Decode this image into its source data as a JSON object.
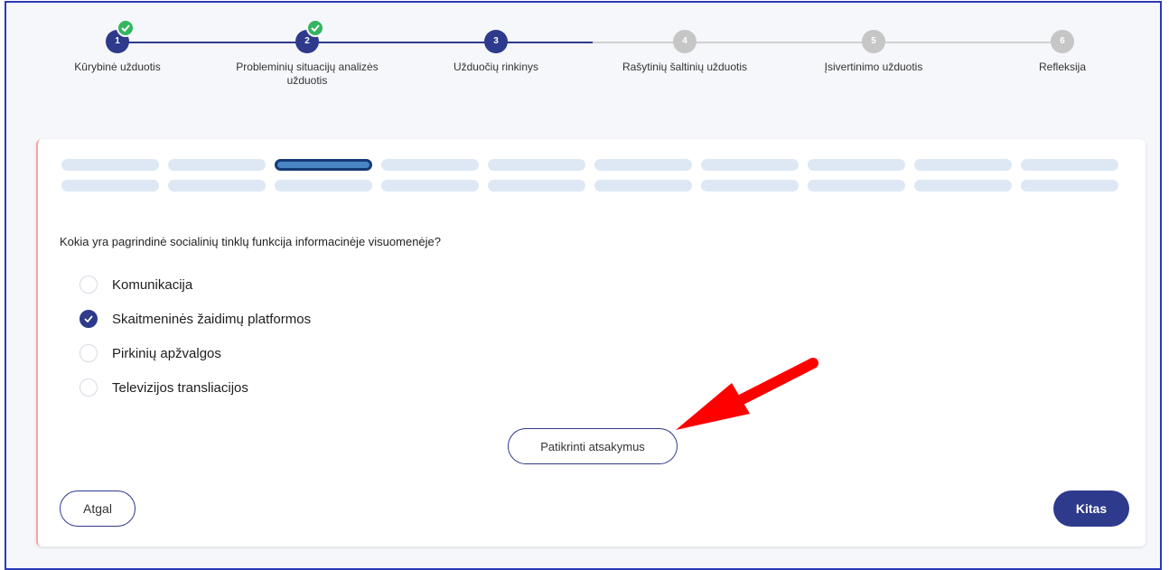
{
  "stepper": {
    "steps": [
      {
        "number": "1",
        "label": "Kūrybinė užduotis",
        "state": "done"
      },
      {
        "number": "2",
        "label": "Probleminių situacijų analizės užduotis",
        "state": "done"
      },
      {
        "number": "3",
        "label": "Užduočių rinkinys",
        "state": "active"
      },
      {
        "number": "4",
        "label": "Rašytinių šaltinių užduotis",
        "state": "pending"
      },
      {
        "number": "5",
        "label": "Įsivertinimo užduotis",
        "state": "pending"
      },
      {
        "number": "6",
        "label": "Refleksija",
        "state": "pending"
      }
    ]
  },
  "quiz": {
    "progress_rows": 2,
    "progress_columns": 10,
    "current_item": 3,
    "question": "Kokia yra pagrindinė socialinių tinklų funkcija informacinėje visuomenėje?",
    "options": [
      {
        "label": "Komunikacija",
        "checked": false
      },
      {
        "label": "Skaitmeninės žaidimų platformos",
        "checked": true
      },
      {
        "label": "Pirkinių apžvalgos",
        "checked": false
      },
      {
        "label": "Televizijos transliacijos",
        "checked": false
      }
    ],
    "check_button": "Patikrinti atsakymus"
  },
  "navigation": {
    "back_label": "Atgal",
    "next_label": "Kitas"
  },
  "colors": {
    "primary": "#2e3a8c",
    "done_check": "#34b55f",
    "pending": "#c6c6c6",
    "pill": "#dde8f4",
    "annotation_arrow": "#ff0000"
  }
}
